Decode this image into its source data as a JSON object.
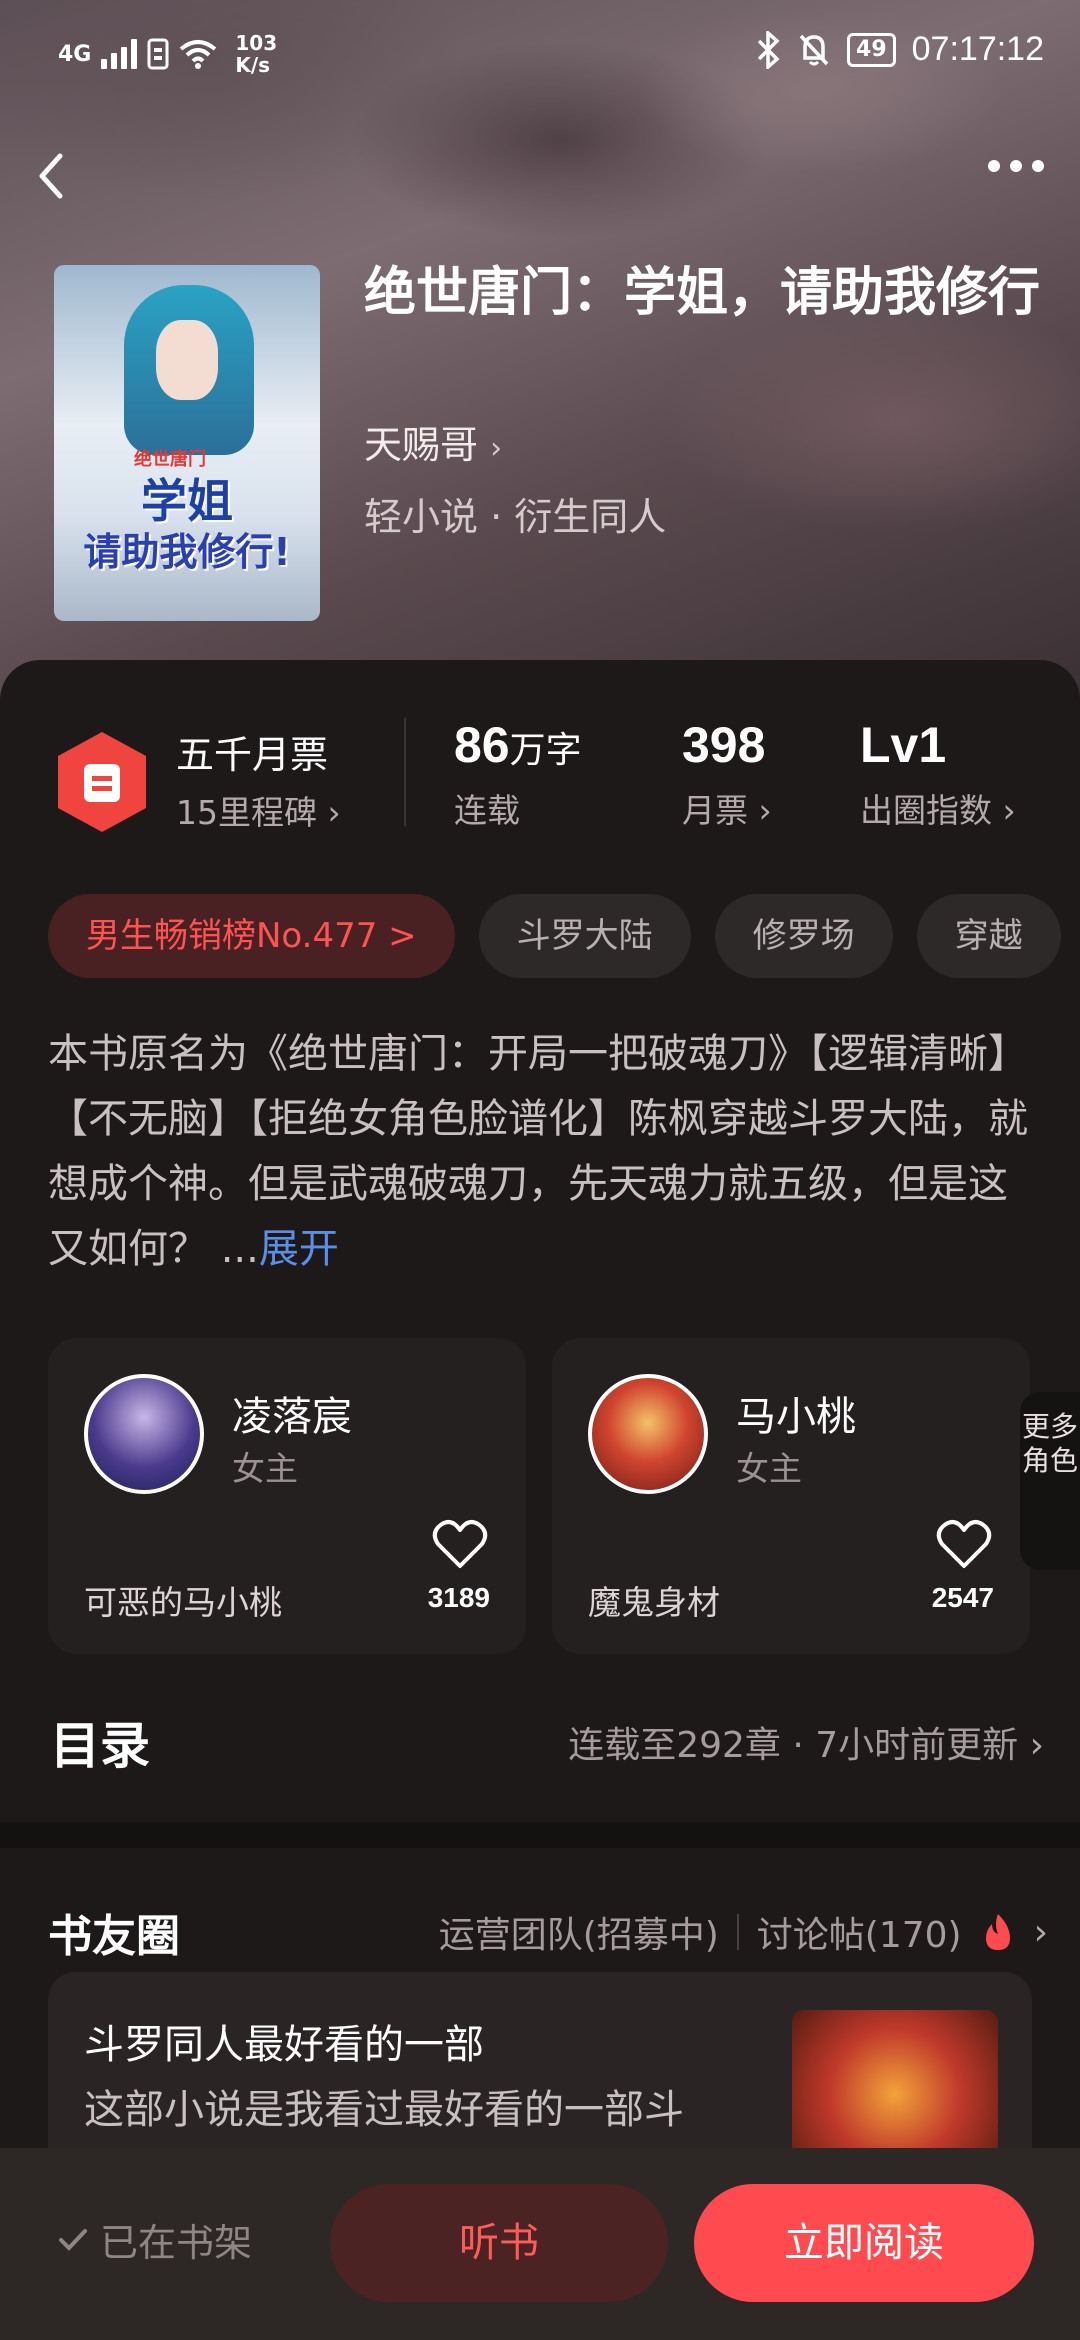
{
  "status_bar": {
    "network": "4G",
    "speed_value": "103",
    "speed_unit": "K/s",
    "battery": "49",
    "time": "07:17:12"
  },
  "book": {
    "title": "绝世唐门：学姐，请助我修行",
    "author": "天赐哥",
    "genre": "轻小说 · 衍生同人",
    "cover": {
      "series_text": "绝世唐门",
      "title_line1": "学姐",
      "title_line2": "请助我修行!"
    }
  },
  "stats": {
    "ticket_name": "五千月票",
    "ticket_sub": "15里程碑",
    "words_value": "86",
    "words_unit": "万字",
    "words_label": "连载",
    "monthly_value": "398",
    "monthly_label": "月票",
    "level_value": "Lv1",
    "level_label": "出圈指数"
  },
  "tags": [
    "男生畅销榜No.477 >",
    "斗罗大陆",
    "修罗场",
    "穿越"
  ],
  "description": {
    "text": "本书原名为《绝世唐门：开局一把破魂刀》【逻辑清晰】【不无脑】【拒绝女角色脸谱化】陈枫穿越斗罗大陆，就想成个神。但是武魂破魂刀，先天魂力就五级，但是这又如何？ ...",
    "expand_label": "展开"
  },
  "characters": [
    {
      "name": "凌落宸",
      "role": "女主",
      "highlight": "可恶的马小桃",
      "likes": "3189"
    },
    {
      "name": "马小桃",
      "role": "女主",
      "highlight": "魔鬼身材",
      "likes": "2547"
    }
  ],
  "more_roles_label": "更多角色",
  "catalog": {
    "title": "目录",
    "info": "连载至292章 · 7小时前更新"
  },
  "friends": {
    "title": "书友圈",
    "team_link": "运营团队(招募中)",
    "discussion_link": "讨论帖(170)",
    "post_title": "斗罗同人最好看的一部",
    "post_body": "这部小说是我看过最好看的一部斗"
  },
  "bottom": {
    "shelf_label": "已在书架",
    "listen_label": "听书",
    "read_label": "立即阅读"
  },
  "colors": {
    "accent": "#ff4b4f",
    "link": "#5b8fe6",
    "background": "#1d1919"
  }
}
